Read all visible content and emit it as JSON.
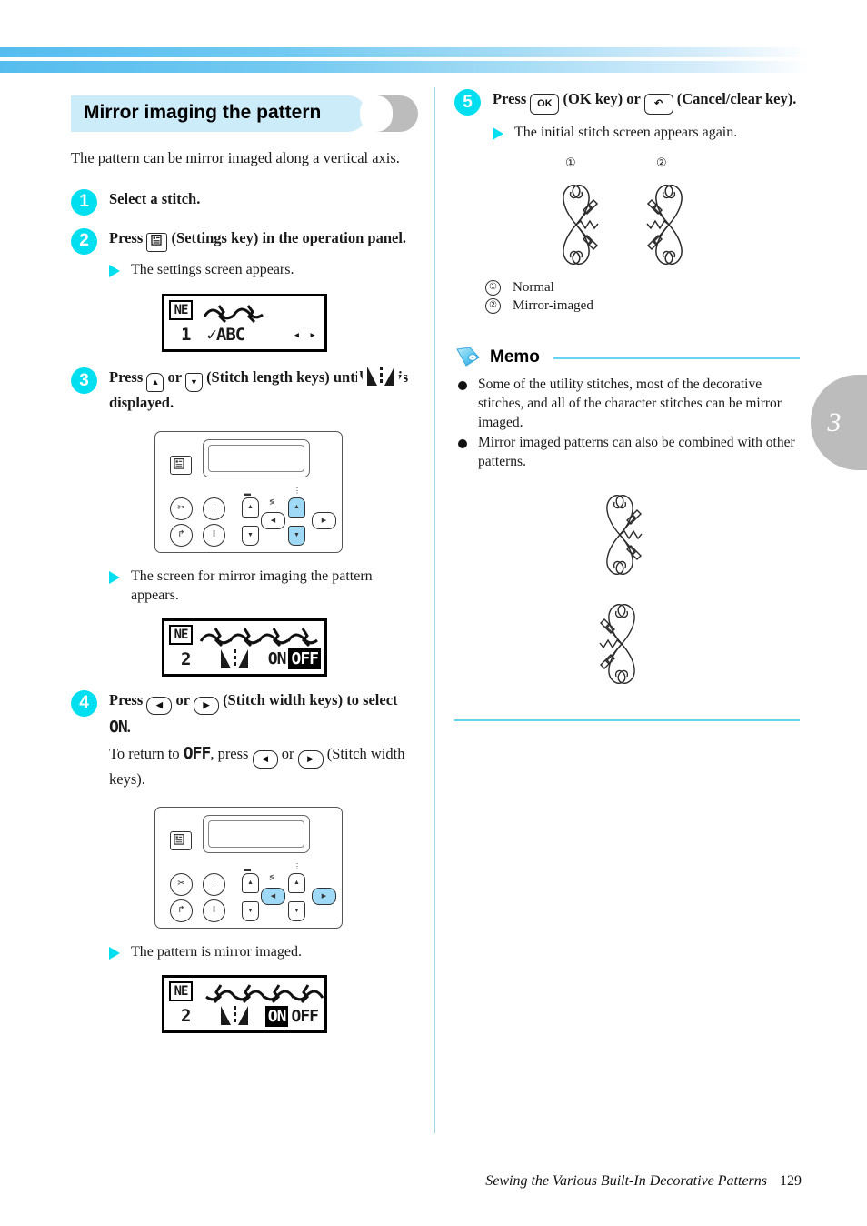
{
  "page": {
    "chapter_tab": "3",
    "footer_title": "Sewing the Various Built-In Decorative Patterns",
    "footer_page": "129"
  },
  "section": {
    "heading": "Mirror imaging the pattern",
    "intro": "The pattern can be mirror imaged along a vertical axis."
  },
  "steps": [
    {
      "num": "1",
      "text": "Select a stitch."
    },
    {
      "num": "2",
      "text_before": "Press",
      "key_label": "settings-key",
      "text_after": "(Settings key) in the operation panel.",
      "note": "The settings screen appears."
    },
    {
      "num": "3",
      "text_before": "Press",
      "key_up": "▲",
      "or": "or",
      "key_down": "▼",
      "text_mid": "(Stitch length keys) until",
      "text_after": "is displayed.",
      "note": "The screen for mirror imaging the pattern appears."
    },
    {
      "num": "4",
      "text_before": "Press",
      "key_left": "◀",
      "or": "or",
      "key_right": "▶",
      "text_mid": "(Stitch width keys) to select",
      "on": "ON",
      "return_before": "To return to",
      "off": "OFF",
      "return_mid": ", press",
      "return_after": "(Stitch width keys).",
      "note": "The pattern is mirror imaged."
    },
    {
      "num": "5",
      "text_before": "Press",
      "ok_key": "OK",
      "text_mid": "(OK key) or",
      "cancel_key": "↶",
      "text_after": "(Cancel/clear key).",
      "note": "The initial stitch screen appears again."
    }
  ],
  "lcd_settings": {
    "badge": "NE",
    "number": "1",
    "label": "✓ABC",
    "arrows": "◂ ▸"
  },
  "lcd_mirror_off": {
    "badge": "NE",
    "number": "2",
    "on": "ON",
    "off": "OFF",
    "selected": "OFF"
  },
  "lcd_mirror_on": {
    "badge": "NE",
    "number": "2",
    "on": "ON",
    "off": "OFF",
    "selected": "ON"
  },
  "panel": {
    "settings_key": "settings-key-icon",
    "thread_cutter": "✂",
    "needle_position": "!",
    "reverse_stitch": "↱",
    "reinforcement": "‖",
    "length_up": "▲",
    "length_down": "▼",
    "width_left": "◀",
    "width_right": "▶",
    "highlight_step3": "stitch-length-keys",
    "highlight_step4": "stitch-width-keys"
  },
  "figure": {
    "marker_1": "①",
    "marker_2": "②",
    "legend": [
      {
        "marker": "①",
        "label": "Normal"
      },
      {
        "marker": "②",
        "label": "Mirror-imaged"
      }
    ]
  },
  "memo": {
    "title": "Memo",
    "items": [
      "Some of the utility stitches, most of the decorative stitches, and all of the character stitches can be mirror imaged.",
      "Mirror imaged patterns can also be combined with other patterns."
    ]
  },
  "colors": {
    "accent_cyan": "#00dff0",
    "banner_blue": "#55bdee",
    "heading_bg": "#cdecfa",
    "tab_gray": "#bcbcbc",
    "panel_highlight": "#9fd9f5"
  }
}
